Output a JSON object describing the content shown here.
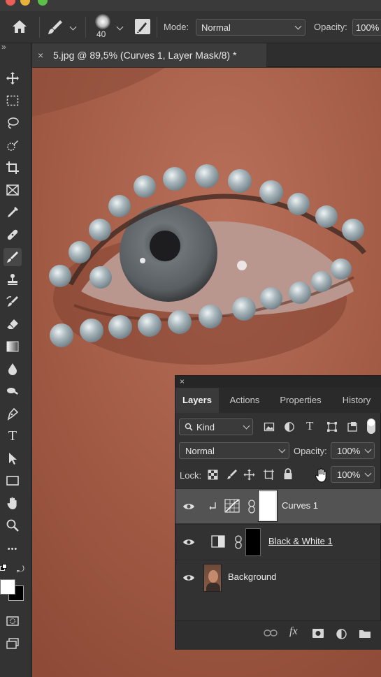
{
  "options_bar": {
    "brush_size": "40",
    "mode_label": "Mode:",
    "mode_value": "Normal",
    "opacity_label": "Opacity:",
    "opacity_value": "100%"
  },
  "toolbar": {
    "collapse_glyph": "»",
    "tools": [
      "move-icon",
      "marquee-icon",
      "lasso-icon",
      "quick-select-icon",
      "crop-icon",
      "frame-icon",
      "eyedropper-icon",
      "healing-icon",
      "brush-icon",
      "stamp-icon",
      "history-brush-icon",
      "eraser-icon",
      "gradient-icon",
      "blur-icon",
      "dodge-icon",
      "pen-icon",
      "type-icon",
      "path-select-icon",
      "rectangle-icon",
      "hand-icon",
      "zoom-icon",
      "more-icon"
    ],
    "type_tool_glyph": "T",
    "more_glyph": "•••"
  },
  "document": {
    "tab_title": "5.jpg @ 89,5% (Curves 1, Layer Mask/8) *",
    "close_glyph": "×"
  },
  "layers_panel": {
    "close_glyph": "×",
    "tabs": [
      "Layers",
      "Actions",
      "Properties",
      "History"
    ],
    "active_tab": "Layers",
    "filter_value": "Kind",
    "blend_mode": "Normal",
    "opacity_label": "Opacity:",
    "opacity_value": "100%",
    "lock_label": "Lock:",
    "fill_value": "100%",
    "fx_label": "fx",
    "layers": [
      {
        "name": "Curves 1",
        "selected": true
      },
      {
        "name": "Black & White 1",
        "selected": false
      },
      {
        "name": "Background",
        "selected": false
      }
    ]
  },
  "colors": {
    "skin": "#a25b44",
    "pearl": "#a9b7bd",
    "panel_bg": "#323232",
    "selected_layer": "#535353"
  }
}
